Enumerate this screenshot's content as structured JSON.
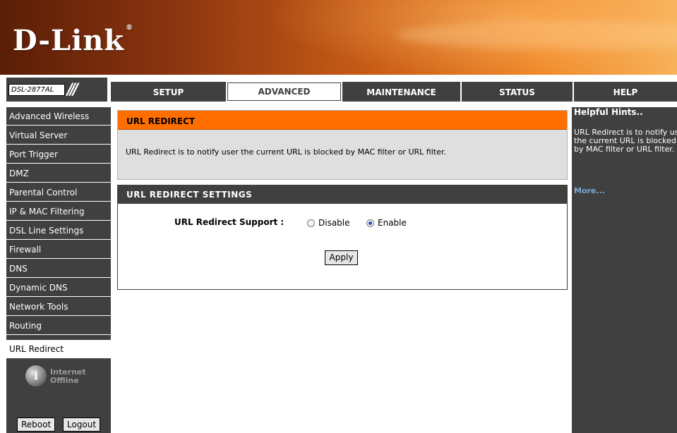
{
  "brand": {
    "logo_text": "D-Link",
    "trademark": "®"
  },
  "model": {
    "label": "DSL-2877AL",
    "slashes": "///"
  },
  "tabs": [
    {
      "label": "SETUP",
      "active": false
    },
    {
      "label": "ADVANCED",
      "active": true
    },
    {
      "label": "MAINTENANCE",
      "active": false
    },
    {
      "label": "STATUS",
      "active": false
    },
    {
      "label": "HELP",
      "active": false
    }
  ],
  "sidebar": {
    "items": [
      {
        "label": "Advanced Wireless"
      },
      {
        "label": "Virtual Server"
      },
      {
        "label": "Port Trigger"
      },
      {
        "label": "DMZ"
      },
      {
        "label": "Parental Control"
      },
      {
        "label": "IP & MAC Filtering"
      },
      {
        "label": "DSL Line Settings"
      },
      {
        "label": "Firewall"
      },
      {
        "label": "DNS"
      },
      {
        "label": "Dynamic DNS"
      },
      {
        "label": "Network Tools"
      },
      {
        "label": "Routing"
      },
      {
        "label": "URL Redirect",
        "active": true
      }
    ],
    "status_line1": "Internet",
    "status_line2": "Offline",
    "reboot_label": "Reboot",
    "logout_label": "Logout"
  },
  "main": {
    "section_title": "URL REDIRECT",
    "description": "URL Redirect is to notify user the current URL is blocked by MAC filter or URL filter.",
    "settings_title": "URL REDIRECT SETTINGS",
    "support_label": "URL Redirect Support :",
    "option_disable": "Disable",
    "option_enable": "Enable",
    "selected": "Enable",
    "apply_label": "Apply"
  },
  "hints": {
    "title": "Helpful Hints..",
    "text": "URL Redirect is to notify user the current URL is blocked by MAC filter or URL filter.",
    "more": "More..."
  },
  "colors": {
    "orange": "#ff6e00",
    "dark_gray": "#404040",
    "link": "#7aa8d8"
  }
}
